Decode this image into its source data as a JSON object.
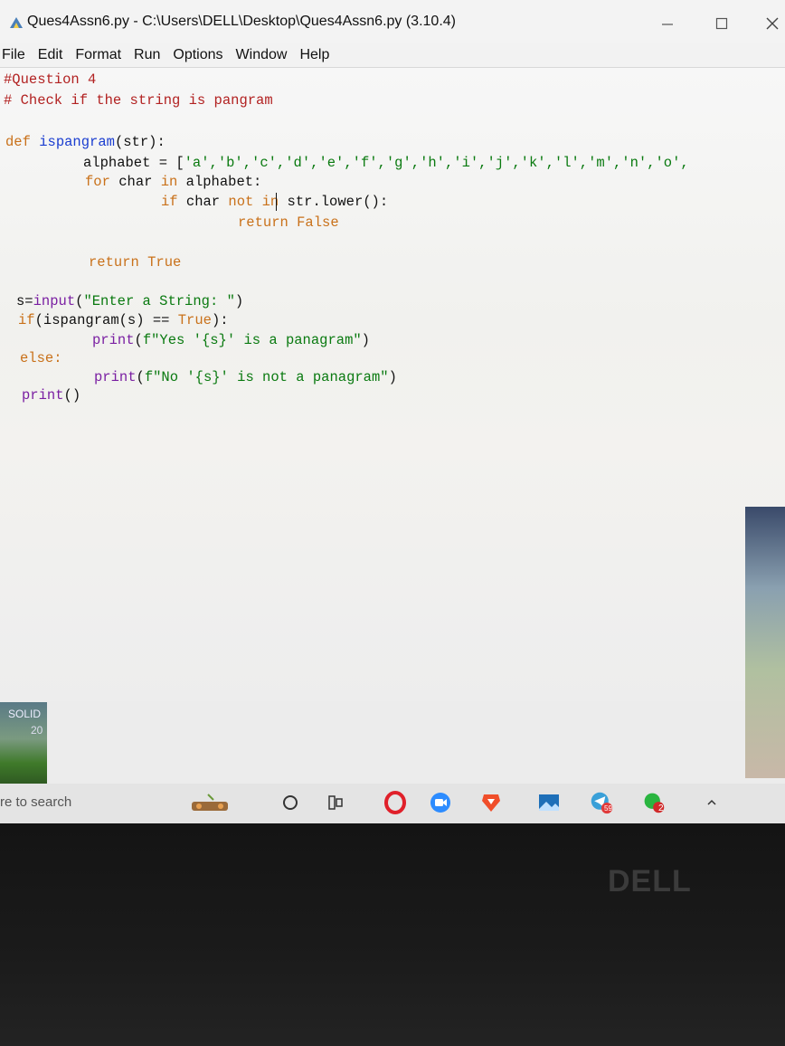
{
  "window": {
    "title": "Ques4Assn6.py - C:\\Users\\DELL\\Desktop\\Ques4Assn6.py (3.10.4)",
    "app_icon": "python-idle-icon",
    "controls": {
      "minimize": "minimize-icon",
      "maximize": "maximize-icon",
      "close": "close-icon"
    }
  },
  "menu": [
    "File",
    "Edit",
    "Format",
    "Run",
    "Options",
    "Window",
    "Help"
  ],
  "code": {
    "l1": "#Question 4",
    "l2": "# Check if the string is pangram",
    "l3_kw": "def ",
    "l3_fn": "ispangram",
    "l3_rest": "(str):",
    "l4_a": "alphabet = [",
    "l4_list": "'a','b','c','d','e','f','g','h','i','j','k','l','m','n','o',",
    "l5_for": "for ",
    "l5_char": "char ",
    "l5_in": "in ",
    "l5_rest": "alphabet:",
    "l6_if": "if ",
    "l6_char": "char ",
    "l6_notin": "not in ",
    "l6_rest": "str.lower():",
    "l7_ret": "return ",
    "l7_val": "False",
    "l8_ret": "return ",
    "l8_val": "True",
    "l9_a": "s=",
    "l9_input": "input",
    "l9_b": "(",
    "l9_str": "\"Enter a String: \"",
    "l9_c": ")",
    "l10_if": "if",
    "l10_a": "(ispangram(s) == ",
    "l10_val": "True",
    "l10_b": "):",
    "l11_print": "print",
    "l11_a": "(",
    "l11_str": "f\"Yes '{s}' is a panagram\"",
    "l11_b": ")",
    "l12_else": "else:",
    "l13_print": "print",
    "l13_a": "(",
    "l13_str": "f\"No '{s}' is not a panagram\"",
    "l13_b": ")",
    "l14_print": "print",
    "l14_a": "()"
  },
  "desktop": {
    "label": "SOLID",
    "sub": "20"
  },
  "taskbar": {
    "search_placeholder": "re to search",
    "icons": [
      "game-icon",
      "cortana-circle-icon",
      "task-view-icon",
      "opera-icon",
      "zoom-icon",
      "brave-icon",
      "photos-icon",
      "telegram-icon",
      "whatsapp-icon",
      "tray-arrow-icon"
    ],
    "telegram_badge": "59",
    "whatsapp_badge": "2"
  },
  "bezel": {
    "brand": "DELL"
  },
  "colors": {
    "keyword": "#c9711a",
    "comment": "#b22222",
    "function": "#1a3dd0",
    "builtin": "#7a1fa2",
    "string": "#0a7a10"
  }
}
